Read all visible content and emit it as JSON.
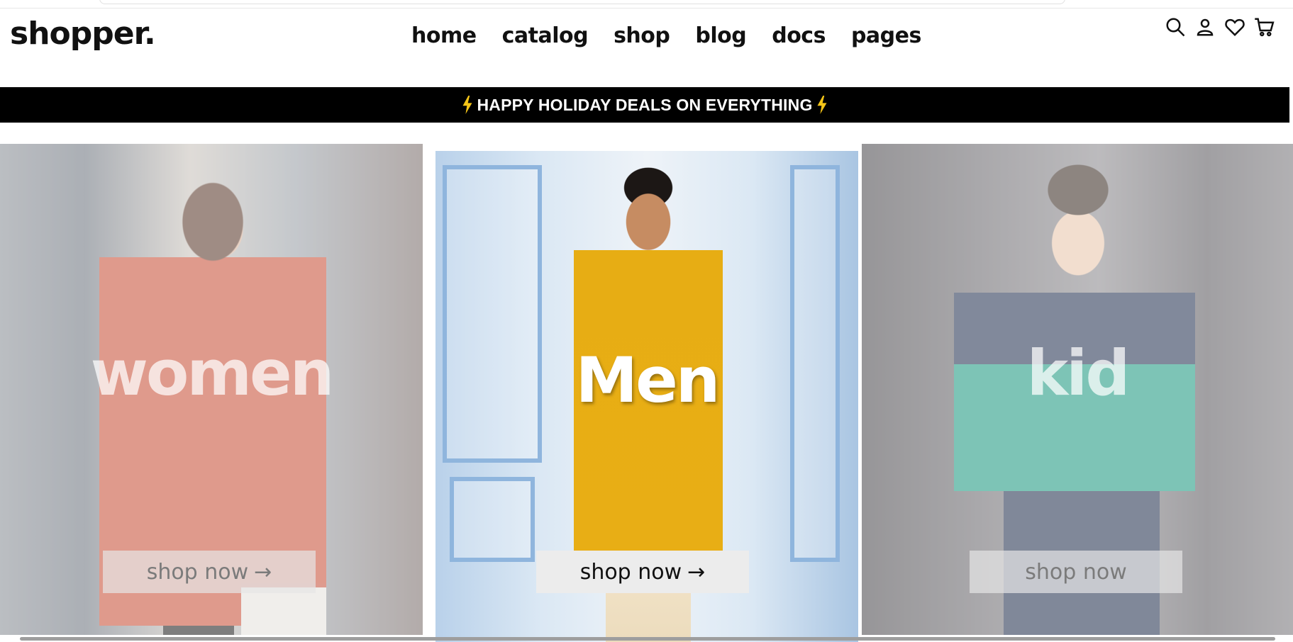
{
  "brand": {
    "logo": "shopper."
  },
  "nav": {
    "items": [
      {
        "label": "home"
      },
      {
        "label": "catalog"
      },
      {
        "label": "shop"
      },
      {
        "label": "blog"
      },
      {
        "label": "docs"
      },
      {
        "label": "pages"
      }
    ],
    "icons": [
      "search-icon",
      "user-icon",
      "heart-icon",
      "cart-icon"
    ]
  },
  "announcement": {
    "text": "HAPPY HOLIDAY DEALS ON EVERYTHING",
    "icon": "lightning-bolt-icon",
    "icon_color": "#f5c518",
    "background": "#000000"
  },
  "categories": [
    {
      "title": "women",
      "button": "shop now",
      "arrow": "→",
      "state": "faded"
    },
    {
      "title": "Men",
      "button": "shop now",
      "arrow": "→",
      "state": "active"
    },
    {
      "title": "kid",
      "button": "shop now",
      "arrow": "",
      "state": "faded"
    }
  ]
}
